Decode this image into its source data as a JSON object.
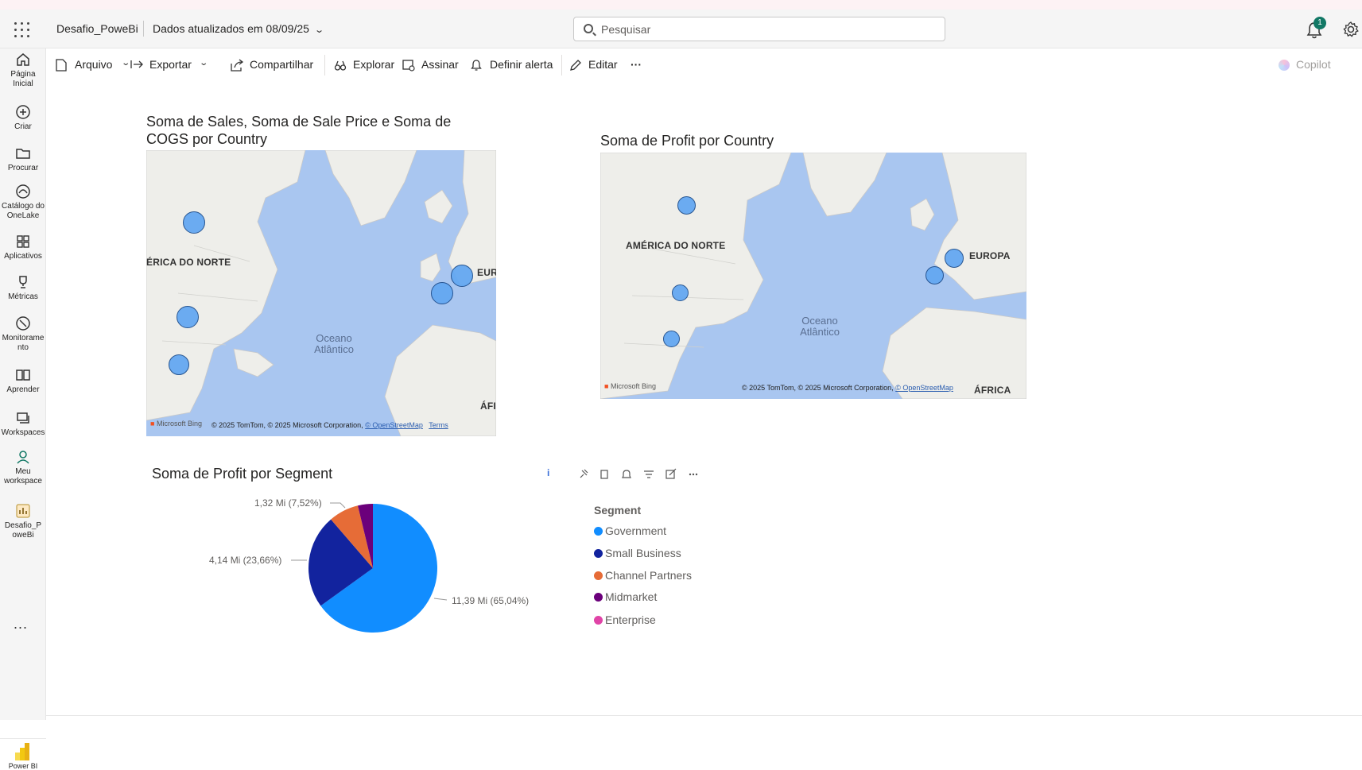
{
  "topbar": {
    "report_name": "Desafio_PoweBi",
    "updated": "Dados atualizados em 08/09/25",
    "search_placeholder": "Pesquisar",
    "notification_count": "1"
  },
  "leftnav": {
    "items": [
      {
        "label": "Página Inicial",
        "icon": "home-icon"
      },
      {
        "label": "Criar",
        "icon": "plus-circle-icon"
      },
      {
        "label": "Procurar",
        "icon": "folder-icon"
      },
      {
        "label": "Catálogo do OneLake",
        "icon": "onelake-icon"
      },
      {
        "label": "Aplicativos",
        "icon": "apps-icon"
      },
      {
        "label": "Métricas",
        "icon": "trophy-icon"
      },
      {
        "label": "Monitoramento",
        "icon": "monitor-icon"
      },
      {
        "label": "Aprender",
        "icon": "book-icon"
      },
      {
        "label": "Workspaces",
        "icon": "workspaces-icon"
      },
      {
        "label": "Meu workspace",
        "icon": "person-icon"
      },
      {
        "label": "Desafio_PoweBi",
        "icon": "report-icon"
      }
    ],
    "more": "...",
    "powerbi_label": "Power BI"
  },
  "cmdbar": {
    "arquivo": "Arquivo",
    "exportar": "Exportar",
    "compartilhar": "Compartilhar",
    "explorar": "Explorar",
    "assinar": "Assinar",
    "definir_alerta": "Definir alerta",
    "editar": "Editar",
    "more": "···",
    "copilot": "Copilot"
  },
  "map1": {
    "title": "Soma de Sales, Soma de Sale Price e Soma de COGS por Country",
    "labels": {
      "continent": "ÉRICA DO NORTE",
      "europe": "EUR",
      "africa": "ÁFI",
      "ocean": "Oceano\nAtlântico"
    },
    "bing": "Microsoft Bing",
    "copyright": "© 2025 TomTom, © 2025 Microsoft Corporation,",
    "osm": "© OpenStreetMap",
    "terms": "Terms"
  },
  "map2": {
    "title": "Soma de Profit por Country",
    "labels": {
      "continent": "AMÉRICA DO NORTE",
      "europe": "EUROPA",
      "africa": "ÁFRICA",
      "ocean": "Oceano\nAtlântico"
    },
    "bing": "Microsoft Bing",
    "copyright": "© 2025 TomTom, © 2025 Microsoft Corporation,",
    "osm": "© OpenStreetMap",
    "terms": "Terms"
  },
  "pie": {
    "title": "Soma de Profit por Segment",
    "legend_title": "Segment",
    "slices": [
      {
        "name": "Government",
        "value": 11.39,
        "pct": 65.04,
        "label": "11,39 Mi (65,04%)",
        "color": "#118DFF"
      },
      {
        "name": "Small Business",
        "value": 4.14,
        "pct": 23.66,
        "label": "4,14 Mi (23,66%)",
        "color": "#12239E"
      },
      {
        "name": "Channel Partners",
        "value": 1.32,
        "pct": 7.52,
        "label": "1,32 Mi (7,52%)",
        "color": "#E66C37"
      },
      {
        "name": "Midmarket",
        "value": 0.66,
        "pct": 3.78,
        "label": "",
        "color": "#6B007B"
      },
      {
        "name": "Enterprise",
        "value": 0.0,
        "pct": 0.0,
        "label": "",
        "color": "#E044A7"
      }
    ]
  },
  "chart_data": {
    "type": "pie",
    "title": "Soma de Profit por Segment",
    "legend_title": "Segment",
    "categories": [
      "Government",
      "Small Business",
      "Channel Partners",
      "Midmarket",
      "Enterprise"
    ],
    "values": [
      11.39,
      4.14,
      1.32,
      0.66,
      0.0
    ],
    "percent": [
      65.04,
      23.66,
      7.52,
      3.78,
      0.0
    ],
    "unit": "Mi",
    "legend_position": "right"
  }
}
